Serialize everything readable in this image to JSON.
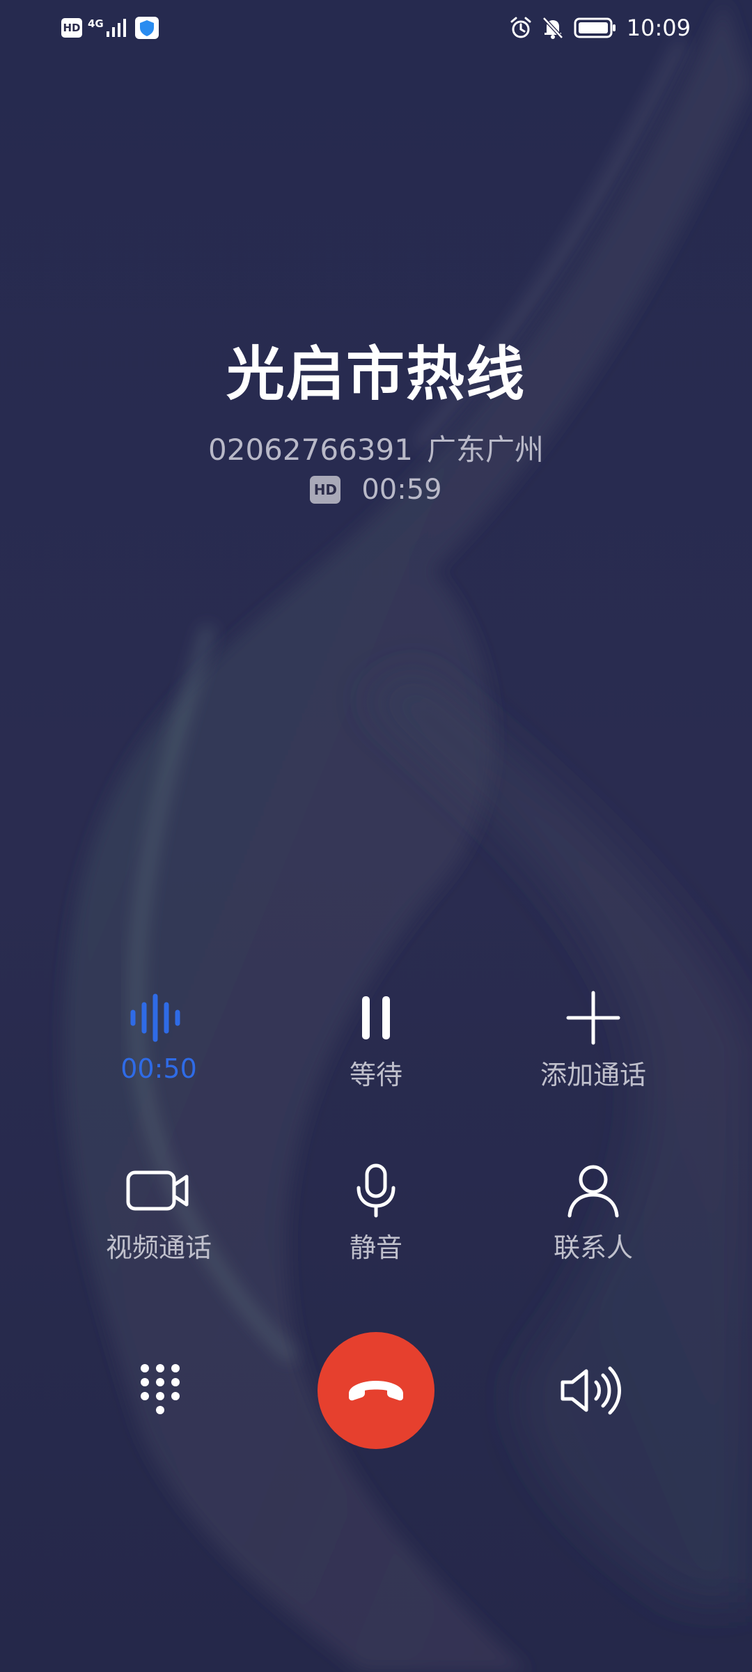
{
  "status_bar": {
    "left_icons": [
      "hd-icon",
      "4g-signal-icon",
      "shield-icon"
    ],
    "hd_label": "HD",
    "network_label": "4G",
    "right_icons": [
      "alarm-icon",
      "bell-muted-icon",
      "battery-icon"
    ],
    "time": "10:09"
  },
  "call": {
    "caller_name": "光启市热线",
    "number": "02062766391",
    "location": "广东广州",
    "hd_badge": "HD",
    "duration": "00:59"
  },
  "actions": [
    {
      "key": "voice-timer",
      "label": "00:50",
      "icon": "voice-wave-icon",
      "accent": "#2f6be6"
    },
    {
      "key": "hold",
      "label": "等待",
      "icon": "pause-icon"
    },
    {
      "key": "add-call",
      "label": "添加通话",
      "icon": "plus-icon"
    },
    {
      "key": "video-call",
      "label": "视频通话",
      "icon": "video-camera-icon"
    },
    {
      "key": "mute",
      "label": "静音",
      "icon": "microphone-icon"
    },
    {
      "key": "contacts",
      "label": "联系人",
      "icon": "person-icon"
    }
  ],
  "bottom": {
    "dialpad_icon": "dialpad-icon",
    "end_call_icon": "hang-up-icon",
    "speaker_icon": "speaker-icon",
    "end_call_color": "#e6402e"
  },
  "colors": {
    "background": "#26264a",
    "accent": "#2f6be6",
    "end_call": "#e6402e"
  }
}
